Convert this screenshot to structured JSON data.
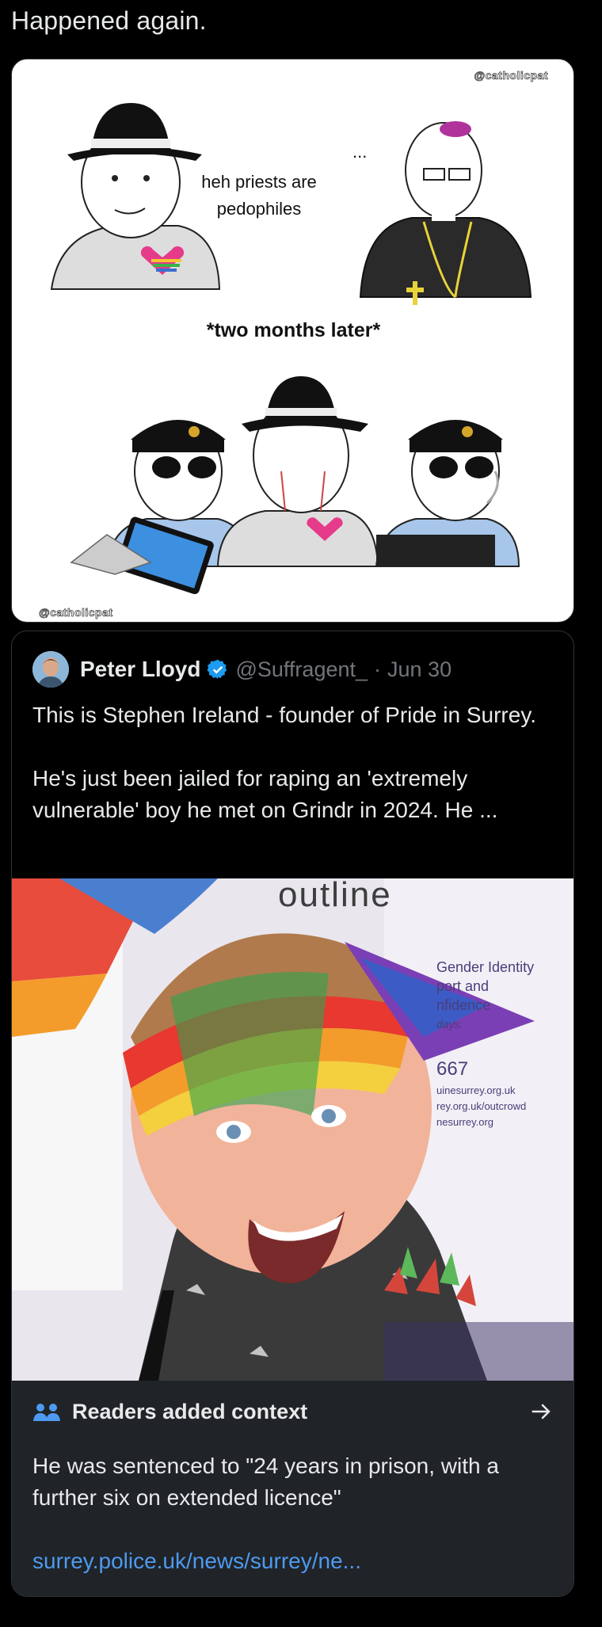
{
  "post": {
    "text": "Happened again."
  },
  "meme": {
    "watermark": "@catholicpat",
    "speech": "heh priests are pedophiles",
    "reply": "...",
    "caption": "*two months later*"
  },
  "quote": {
    "author_name": "Peter Lloyd",
    "handle": "@Suffragent_",
    "separator": "·",
    "date": "Jun 30",
    "paragraph1": "This is Stephen Ireland - founder of Pride in Surrey.",
    "paragraph2": "He's just been jailed for raping an 'extremely vulnerable' boy he met on Grindr in 2024. He ...",
    "photo_banner": {
      "logo": "outline",
      "line1": "Gender Identity",
      "line2": "port and",
      "line3": "nfidence",
      "line4": "days:",
      "phone": "667",
      "url1": "uinesurrey.org.uk",
      "url2": "rey.org.uk/outcrowd",
      "url3": "nesurrey.org"
    }
  },
  "context": {
    "title": "Readers added context",
    "text": "He was sentenced to \"24 years in prison, with a further six on extended licence\"",
    "link": "surrey.police.uk/news/surrey/ne..."
  },
  "colors": {
    "background": "#000000",
    "text": "#e7e9ea",
    "muted": "#71767b",
    "link": "#4d9af0",
    "verified": "#1d9bf0",
    "context_bg": "#202327"
  },
  "icons": {
    "verified": "verified-badge-icon",
    "readers": "people-icon",
    "arrow": "arrow-right-icon"
  }
}
